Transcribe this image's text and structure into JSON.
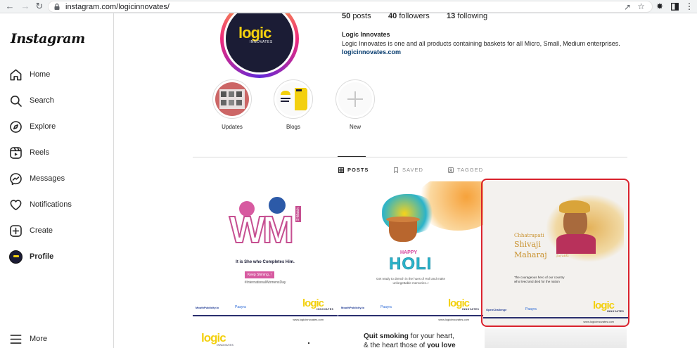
{
  "browser": {
    "url": "instagram.com/logicinnovates/"
  },
  "sidebar": {
    "logo": "Instagram",
    "items": [
      {
        "label": "Home",
        "icon": "home-icon"
      },
      {
        "label": "Search",
        "icon": "search-icon"
      },
      {
        "label": "Explore",
        "icon": "compass-icon"
      },
      {
        "label": "Reels",
        "icon": "reels-icon"
      },
      {
        "label": "Messages",
        "icon": "messenger-icon"
      },
      {
        "label": "Notifications",
        "icon": "heart-icon"
      },
      {
        "label": "Create",
        "icon": "plus-square-icon"
      },
      {
        "label": "Profile",
        "icon": "avatar"
      },
      {
        "label": "More",
        "icon": "hamburger-icon"
      }
    ]
  },
  "profile": {
    "avatar_text": "logic",
    "avatar_subtext": "INNOVATES",
    "posts_count": "50",
    "posts_label": "posts",
    "followers_count": "40",
    "followers_label": "followers",
    "following_count": "13",
    "following_label": "following",
    "name": "Logic Innovates",
    "bio": "Logic Innovates is one and all products containing baskets for all Micro, Small, Medium enterprises.",
    "website": "logicinnovates.com"
  },
  "highlights": [
    {
      "label": "Updates"
    },
    {
      "label": "Blogs"
    },
    {
      "label": "New"
    }
  ],
  "tabs": [
    {
      "label": "POSTS",
      "active": true
    },
    {
      "label": "SAVED",
      "active": false
    },
    {
      "label": "TAGGED",
      "active": false
    }
  ],
  "posts": [
    {
      "logo_text": "WM",
      "tagline": "It is She who Completes Him.",
      "badge": "Keep Shining..!",
      "hashtag": "#InternationalWomensDay",
      "vertical": "S-Match",
      "sponsor1": "MouthPublicity.io",
      "sponsor2": "Paayra",
      "brand": "logic",
      "brand_sub": "INNOVATES",
      "url": "www.logicinnovates.com"
    },
    {
      "title_small": "HAPPY",
      "title": "HOLI",
      "caption": "Get ready to drench in the hues of Holi and make unforgettable memories..!",
      "sponsor1": "MouthPublicity.io",
      "sponsor2": "Paayra",
      "brand": "logic",
      "brand_sub": "INNOVATES",
      "url": "www.logicinnovates.com"
    },
    {
      "line1": "Chhatrapati",
      "line2": "Shivaji",
      "line3": "Maharaj",
      "line4": "Jayanti",
      "caption1": "The courageous hero of our country",
      "caption2": "who lived and died for the nation",
      "sponsor1": "OpenChallenge",
      "sponsor2": "Paayra",
      "brand": "logic",
      "brand_sub": "INNOVATES",
      "url": "www.logicinnovates.com"
    },
    {
      "brand": "logic",
      "brand_sub": "INNOVATES"
    },
    {
      "line1a": "Quit smoking",
      "line1b": " for your heart,",
      "line2a": "& the heart those of ",
      "line2b": "you love"
    }
  ],
  "colors": {
    "brand_yellow": "#f3d00f",
    "brand_navy": "#1b1c35",
    "selection_red": "#d9232d",
    "link_blue": "#00376b"
  }
}
